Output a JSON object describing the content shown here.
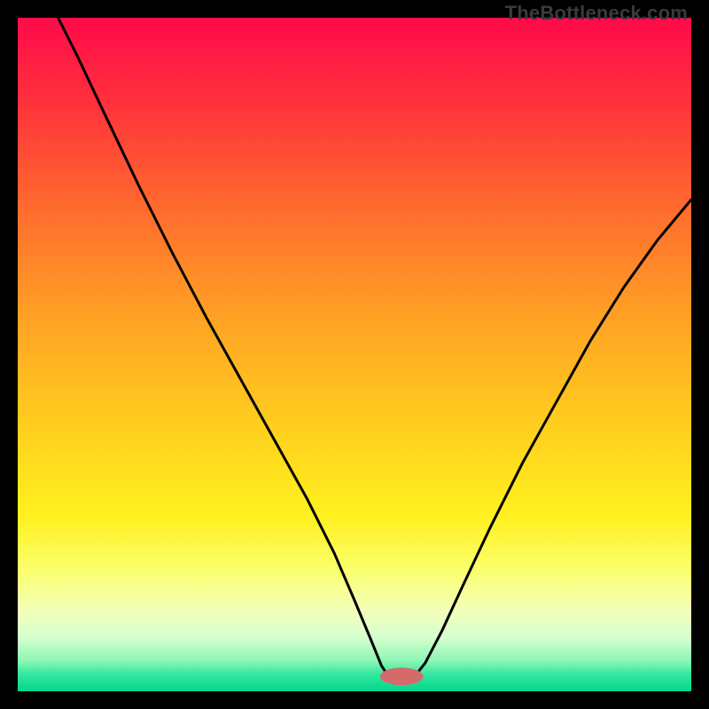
{
  "watermark": "TheBottleneck.com",
  "colors": {
    "gradient_stops": [
      {
        "offset": 0.0,
        "color": "#ff0a4a"
      },
      {
        "offset": 0.12,
        "color": "#ff2f3c"
      },
      {
        "offset": 0.28,
        "color": "#ff6a2e"
      },
      {
        "offset": 0.45,
        "color": "#ffa324"
      },
      {
        "offset": 0.62,
        "color": "#ffd21e"
      },
      {
        "offset": 0.74,
        "color": "#fff11e"
      },
      {
        "offset": 0.82,
        "color": "#fbff6e"
      },
      {
        "offset": 0.88,
        "color": "#f3ffb8"
      },
      {
        "offset": 0.92,
        "color": "#d6ffcf"
      },
      {
        "offset": 0.955,
        "color": "#8bf7b4"
      },
      {
        "offset": 0.975,
        "color": "#33e7a0"
      },
      {
        "offset": 1.0,
        "color": "#00d789"
      }
    ],
    "curve": "#000000",
    "marker_fill": "#d46a6a",
    "marker_stroke": "#d46a6a"
  },
  "chart_data": {
    "type": "line",
    "title": "",
    "xlabel": "",
    "ylabel": "",
    "xlim": [
      0,
      100
    ],
    "ylim": [
      0,
      100
    ],
    "marker": {
      "x": 57,
      "y": 2.2,
      "rx": 3.2,
      "ry": 1.3
    },
    "series": [
      {
        "name": "bottleneck-curve",
        "points": [
          {
            "x": 6.0,
            "y": 100.0
          },
          {
            "x": 9.0,
            "y": 94.0
          },
          {
            "x": 13.0,
            "y": 85.5
          },
          {
            "x": 18.0,
            "y": 75.0
          },
          {
            "x": 23.0,
            "y": 65.0
          },
          {
            "x": 28.0,
            "y": 55.5
          },
          {
            "x": 33.0,
            "y": 46.5
          },
          {
            "x": 38.0,
            "y": 37.5
          },
          {
            "x": 43.0,
            "y": 28.5
          },
          {
            "x": 47.0,
            "y": 20.5
          },
          {
            "x": 50.0,
            "y": 13.5
          },
          {
            "x": 52.5,
            "y": 7.5
          },
          {
            "x": 54.0,
            "y": 3.8
          },
          {
            "x": 55.0,
            "y": 2.3
          },
          {
            "x": 56.5,
            "y": 2.0
          },
          {
            "x": 58.0,
            "y": 2.0
          },
          {
            "x": 59.0,
            "y": 2.3
          },
          {
            "x": 60.5,
            "y": 4.2
          },
          {
            "x": 63.0,
            "y": 9.0
          },
          {
            "x": 66.0,
            "y": 15.5
          },
          {
            "x": 70.0,
            "y": 24.0
          },
          {
            "x": 75.0,
            "y": 34.0
          },
          {
            "x": 80.0,
            "y": 43.0
          },
          {
            "x": 85.0,
            "y": 52.0
          },
          {
            "x": 90.0,
            "y": 60.0
          },
          {
            "x": 95.0,
            "y": 67.0
          },
          {
            "x": 100.0,
            "y": 73.0
          }
        ]
      }
    ]
  }
}
